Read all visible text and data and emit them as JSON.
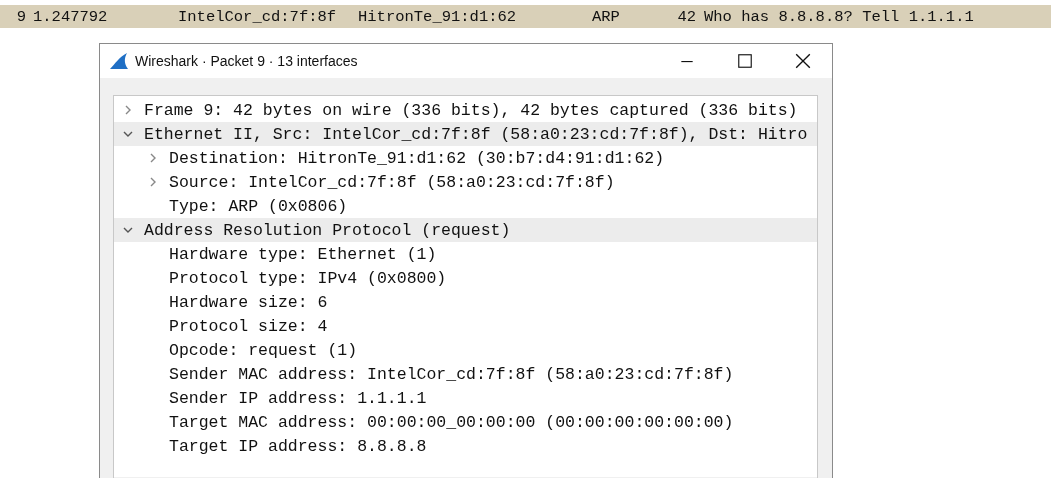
{
  "packet_row": {
    "selected": true,
    "cells": [
      "9",
      "1.247792",
      "IntelCor_cd:7f:8f",
      "HitronTe_91:d1:62",
      "ARP",
      "42",
      "Who has 8.8.8.8? Tell 1.1.1.1"
    ]
  },
  "window": {
    "title": "Wireshark · Packet 9 · 13 interfaces"
  },
  "tree": [
    {
      "label": "Frame 9: 42 bytes on wire (336 bits), 42 bytes captured (336 bits)",
      "expanded": false
    },
    {
      "label": "Ethernet II, Src: IntelCor_cd:7f:8f (58:a0:23:cd:7f:8f), Dst: Hitro",
      "expanded": true,
      "children": [
        {
          "label": "Destination: HitronTe_91:d1:62 (30:b7:d4:91:d1:62)",
          "expanded": false
        },
        {
          "label": "Source: IntelCor_cd:7f:8f (58:a0:23:cd:7f:8f)",
          "expanded": false
        },
        {
          "label": "Type: ARP (0x0806)"
        }
      ]
    },
    {
      "label": "Address Resolution Protocol (request)",
      "expanded": true,
      "children": [
        {
          "label": "Hardware type: Ethernet (1)"
        },
        {
          "label": "Protocol type: IPv4 (0x0800)"
        },
        {
          "label": "Hardware size: 6"
        },
        {
          "label": "Protocol size: 4"
        },
        {
          "label": "Opcode: request (1)"
        },
        {
          "label": "Sender MAC address: IntelCor_cd:7f:8f (58:a0:23:cd:7f:8f)"
        },
        {
          "label": "Sender IP address: 1.1.1.1"
        },
        {
          "label": "Target MAC address: 00:00:00_00:00:00 (00:00:00:00:00:00)"
        },
        {
          "label": "Target IP address: 8.8.8.8"
        }
      ]
    }
  ]
}
